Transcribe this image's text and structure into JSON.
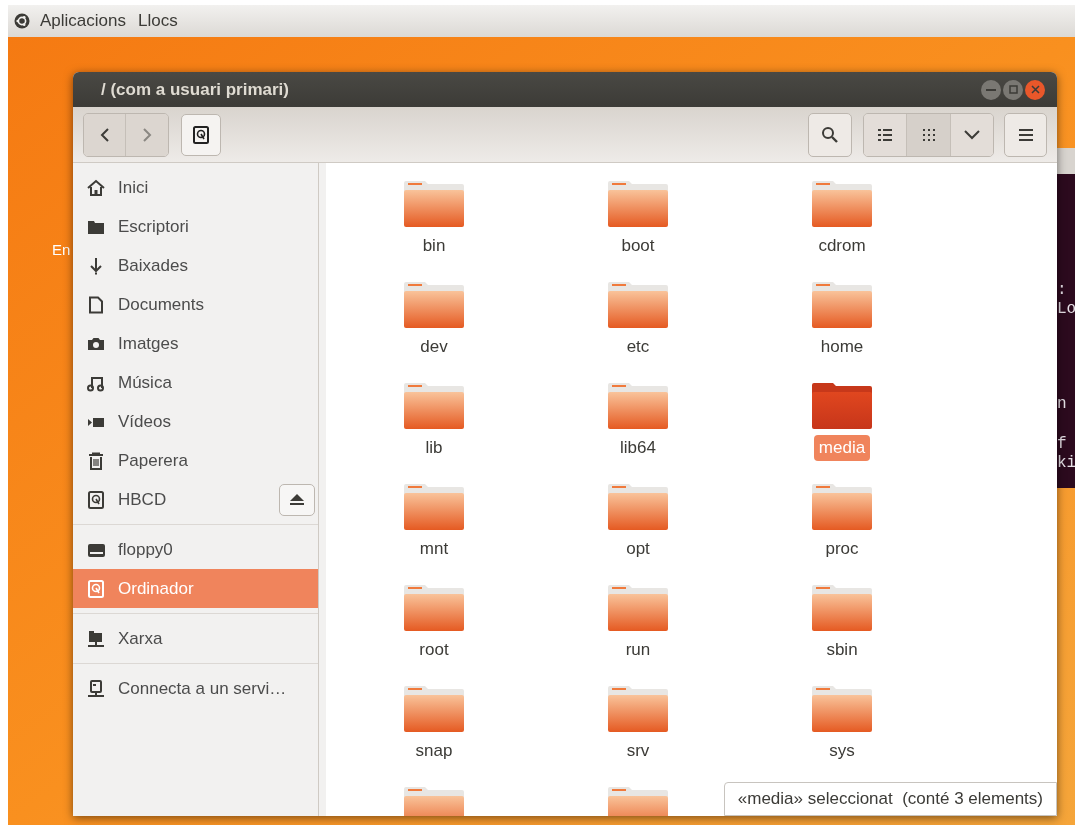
{
  "top_panel": {
    "menus": [
      "Aplicacions",
      "Llocs"
    ]
  },
  "desktop": {
    "icon_label": "En"
  },
  "terminal": {
    "lines": [
      ":",
      "Lo",
      "n",
      "f",
      "ki"
    ]
  },
  "window": {
    "title": "/ (com a usuari primari)"
  },
  "sidebar": {
    "sections": [
      {
        "items": [
          {
            "label": "Inici",
            "selected": false
          },
          {
            "label": "Escriptori",
            "selected": false
          },
          {
            "label": "Baixades",
            "selected": false
          },
          {
            "label": "Documents",
            "selected": false
          },
          {
            "label": "Imatges",
            "selected": false
          },
          {
            "label": "Música",
            "selected": false
          },
          {
            "label": "Vídeos",
            "selected": false
          },
          {
            "label": "Paperera",
            "selected": false
          },
          {
            "label": "HBCD",
            "selected": false,
            "kind": "mount"
          }
        ]
      },
      {
        "items": [
          {
            "label": "floppy0",
            "selected": false
          },
          {
            "label": "Ordinador",
            "selected": true
          }
        ]
      },
      {
        "items": [
          {
            "label": "Xarxa",
            "selected": false
          }
        ]
      },
      {
        "items": [
          {
            "label": "Connecta a un servi…",
            "selected": false
          }
        ]
      }
    ]
  },
  "files": [
    {
      "name": "bin",
      "selected": false
    },
    {
      "name": "boot",
      "selected": false
    },
    {
      "name": "cdrom",
      "selected": false
    },
    {
      "name": "dev",
      "selected": false
    },
    {
      "name": "etc",
      "selected": false
    },
    {
      "name": "home",
      "selected": false
    },
    {
      "name": "lib",
      "selected": false
    },
    {
      "name": "lib64",
      "selected": false
    },
    {
      "name": "media",
      "selected": true
    },
    {
      "name": "mnt",
      "selected": false
    },
    {
      "name": "opt",
      "selected": false
    },
    {
      "name": "proc",
      "selected": false
    },
    {
      "name": "root",
      "selected": false
    },
    {
      "name": "run",
      "selected": false
    },
    {
      "name": "sbin",
      "selected": false
    },
    {
      "name": "snap",
      "selected": false
    },
    {
      "name": "srv",
      "selected": false
    },
    {
      "name": "sys",
      "selected": false
    }
  ],
  "status": "«media» seleccionat  (conté 3 elements)"
}
